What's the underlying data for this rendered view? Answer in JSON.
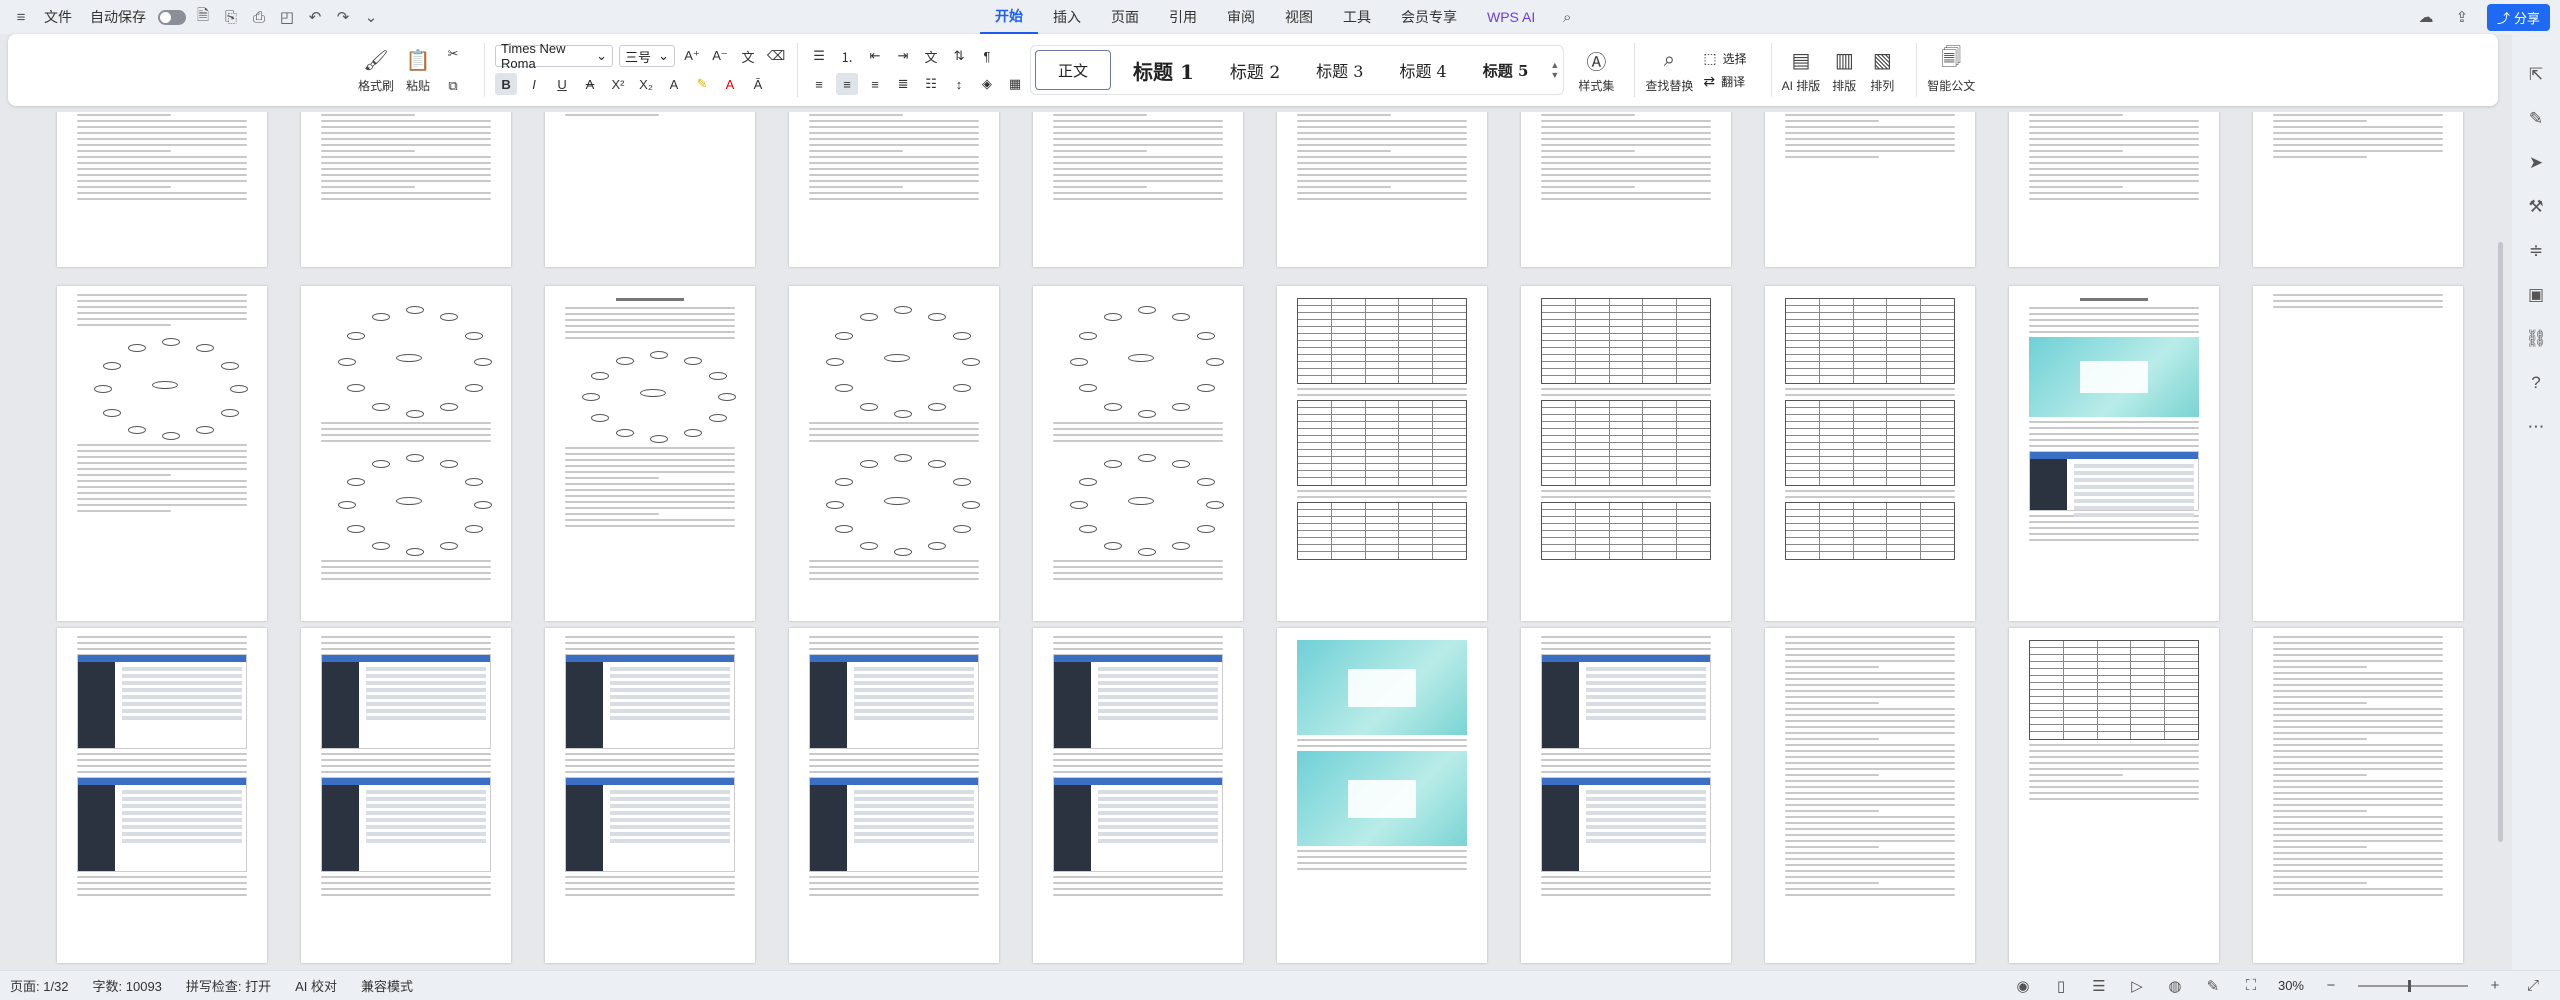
{
  "topbar": {
    "file_label": "文件",
    "autosave_label": "自动保存",
    "tabs": [
      "开始",
      "插入",
      "页面",
      "引用",
      "审阅",
      "视图",
      "工具",
      "会员专享",
      "WPS AI"
    ],
    "share_label": "分享"
  },
  "ribbon": {
    "format_painter": "格式刷",
    "paste": "粘贴",
    "font_name": "Times New Roma",
    "font_size": "三号",
    "styles": [
      "正文",
      "标题 1",
      "标题 2",
      "标题 3",
      "标题 4",
      "标题 5"
    ],
    "style_set": "样式集",
    "find_replace": "查找替换",
    "select": "选择",
    "translate": "翻译",
    "ai_layout": "AI 排版",
    "layout": "排版",
    "arrange": "排列",
    "smart_doc": "智能公文"
  },
  "status": {
    "page": "页面: 1/32",
    "words": "字数: 10093",
    "spellcheck": "拼写检查: 打开",
    "ai_proof": "AI 校对",
    "compat": "兼容模式",
    "zoom": "30%"
  },
  "icons": {
    "undo": "undo-icon",
    "redo": "redo-icon",
    "search": "search-icon",
    "cloud": "cloud-icon"
  }
}
